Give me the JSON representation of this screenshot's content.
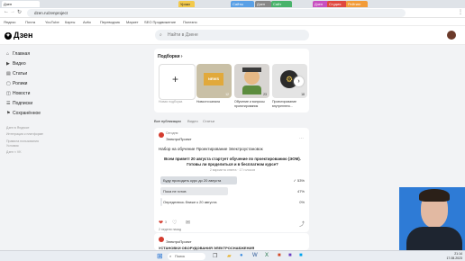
{
  "browser": {
    "tabs": [
      "Дзен",
      "Уроки",
      "Сайты",
      "Дзен",
      "Сайт",
      "Дзен",
      "Студия",
      "Рейтинг"
    ],
    "url": "dzen.ru/zenproject",
    "bookmarks": [
      "Яндекс",
      "Почта",
      "YouTube",
      "Карты",
      "Avito",
      "Переводчик",
      "Маркет",
      "SEO Продвижение",
      "Полезно"
    ]
  },
  "header": {
    "logo": "Дзен",
    "search_placeholder": "Найти в Дзене"
  },
  "sidebar": {
    "items": [
      {
        "icon": "home-icon",
        "label": "Главная"
      },
      {
        "icon": "video-icon",
        "label": "Видео"
      },
      {
        "icon": "articles-icon",
        "label": "Статьи"
      },
      {
        "icon": "shorts-icon",
        "label": "Ролики"
      },
      {
        "icon": "news-icon",
        "label": "Новости"
      },
      {
        "icon": "subscriptions-icon",
        "label": "Подписки"
      },
      {
        "icon": "saved-icon",
        "label": "Сохранённое"
      }
    ],
    "footer": [
      "Дзен в Яндексе",
      "Интеграция к платформе",
      "Правила пользования",
      "Условия",
      "Дзен × VK"
    ]
  },
  "subscriptions": {
    "title": "Подборки",
    "tiles": [
      {
        "label": "Новая подборка",
        "count": ""
      },
      {
        "label": "Новости канала",
        "count": "12"
      },
      {
        "label": "Обучение и вопросы проектирования",
        "count": "23"
      },
      {
        "label": "Проектирование внутреннего...",
        "count": "18"
      }
    ]
  },
  "feed_tabs": [
    "Все публикации",
    "Видео",
    "Статьи"
  ],
  "post": {
    "channel": "ЭлектроПроект",
    "meta": "Сегодня",
    "text": "Набор на обучение Проектирование Электроустановок",
    "question": "Всем привет! 20 августа стартует обучение по проектированию (ЭОМ). Готовы ли проделиться и в бесплатном курсе?",
    "votes": "2 варианта ответа · 17 голосов",
    "options": [
      {
        "label": "Буду проходить курс до 20 августа",
        "percent": 53,
        "shown": "53%",
        "selected": true
      },
      {
        "label": "Пока не готов",
        "percent": 47,
        "shown": "47%",
        "selected": false
      },
      {
        "label": "Определюсь ближе к 20 августа",
        "percent": 0,
        "shown": "0%",
        "selected": false
      }
    ],
    "likes": "3",
    "comments_count": "2 недели назад"
  },
  "post2": {
    "channel": "ЭлектроПроект",
    "text": "УСТАНОВКИ ОБОРУДОВАНИЯ ЭЛЕКТРОСНАБЖЕНИЯ"
  },
  "taskbar": {
    "search": "Поиск",
    "clock": "21:14",
    "date": "17.08.2023"
  }
}
